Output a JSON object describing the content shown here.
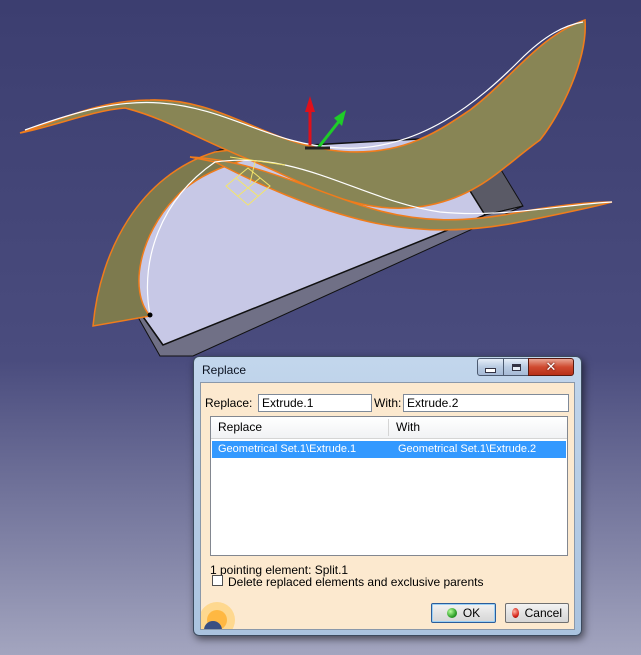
{
  "dialog": {
    "title": "Replace",
    "minimize_icon": "minimize-icon",
    "maximize_icon": "maximize-icon",
    "close_icon": "close-icon",
    "close_glyph": "✕",
    "replace_label": "Replace:",
    "replace_value": "Extrude.1",
    "with_label": "With:",
    "with_value": "Extrude.2",
    "table": {
      "columns": [
        "Replace",
        "With"
      ],
      "rows": [
        {
          "replace": "Geometrical Set.1\\Extrude.1",
          "with": "Geometrical Set.1\\Extrude.2",
          "selected": true
        }
      ]
    },
    "pointing_info": "1 pointing element: Split.1",
    "delete_checkbox_label": "Delete replaced elements and exclusive parents",
    "delete_checked": false,
    "ok_label": "OK",
    "cancel_label": "Cancel"
  },
  "colors": {
    "background_top": "#3c3e70",
    "surface_fill": "#c8c9e8",
    "sweep_fill": "#7d7a4e",
    "sweep_edge": "#f07c1c",
    "selection": "#3399ff",
    "axis_red": "#e0101a",
    "axis_green": "#1ecc28"
  }
}
